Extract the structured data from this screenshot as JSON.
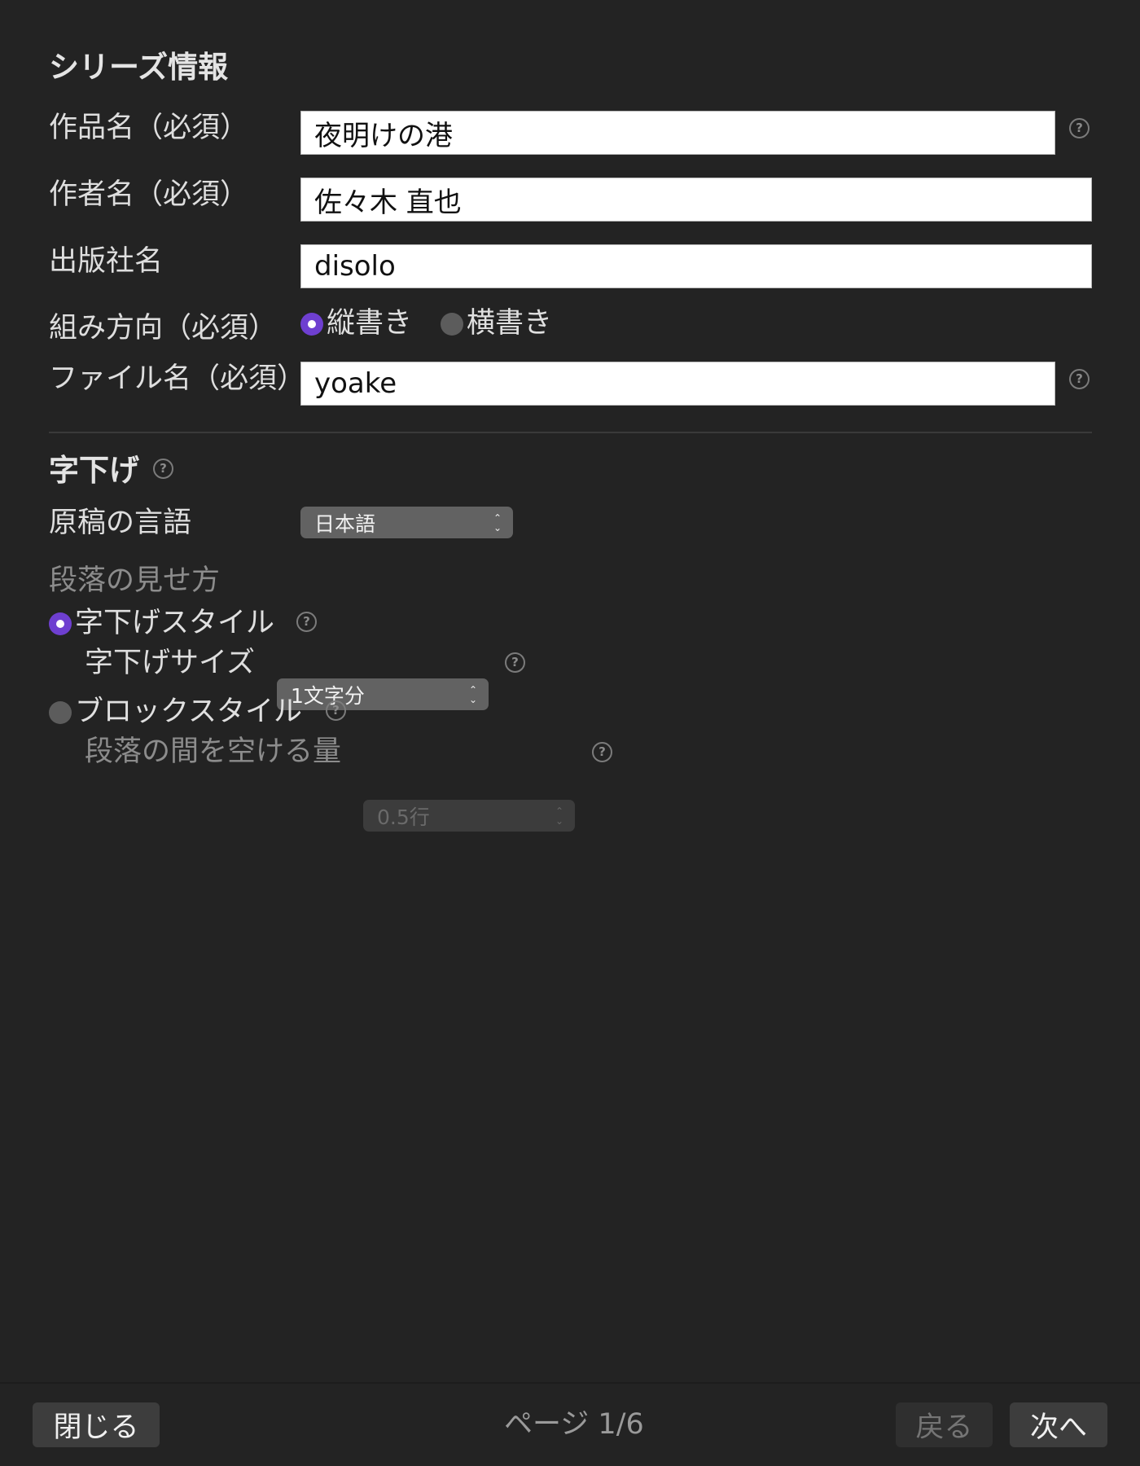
{
  "series": {
    "heading": "シリーズ情報",
    "title_label": "作品名（必須）",
    "title_value": "夜明けの港",
    "author_label": "作者名（必須）",
    "author_value": "佐々木 直也",
    "publisher_label": "出版社名",
    "publisher_value": "disolo",
    "direction_label": "組み方向（必須）",
    "direction_vertical": "縦書き",
    "direction_horizontal": "横書き",
    "direction_selected": "縦書き",
    "filename_label": "ファイル名（必須）",
    "filename_value": "yoake",
    "help_glyph": "?"
  },
  "indent": {
    "heading": "字下げ",
    "language_label": "原稿の言語",
    "language_value": "日本語",
    "paragraph_label": "段落の見せ方",
    "indent_style_label": "字下げスタイル",
    "indent_size_label": "字下げサイズ",
    "indent_size_value": "1文字分",
    "block_style_label": "ブロックスタイル",
    "block_spacing_label": "段落の間を空ける量",
    "block_spacing_value": "0.5行",
    "selected_style": "字下げスタイル"
  },
  "footer": {
    "close_label": "閉じる",
    "page_indicator": "ページ 1/6",
    "back_label": "戻る",
    "next_label": "次へ"
  },
  "colors": {
    "background": "#232323",
    "accent": "#6e3fd0"
  }
}
